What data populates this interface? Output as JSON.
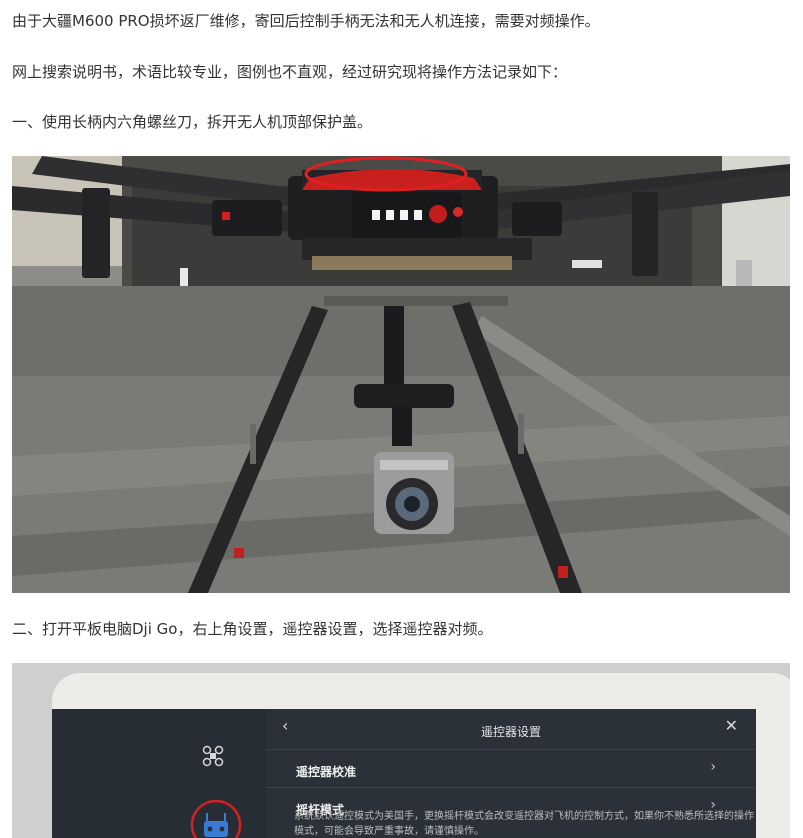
{
  "article": {
    "para1": "由于大疆M600 PRO损坏返厂维修，寄回后控制手柄无法和无人机连接，需要对频操作。",
    "para2": "网上搜索说明书，术语比较专业，图例也不直观，经过研究现将操作方法记录如下：",
    "step1": "一、使用长柄内六角螺丝刀，拆开无人机顶部保护盖。",
    "step2": "二、打开平板电脑Dji Go，右上角设置，遥控器设置，选择遥控器对频。"
  },
  "tablet_screen": {
    "title": "遥控器设置",
    "rows": [
      {
        "label": "遥控器校准"
      },
      {
        "label": "摇杆模式"
      }
    ],
    "stick_mode_desc": "系统默认遥控模式为美国手，更换摇杆模式会改变遥控器对飞机的控制方式，如果你不熟悉所选择的操作模式，可能会导致严重事故，请谨慎操作。",
    "icons": [
      "back-icon",
      "close-icon",
      "drone-icon",
      "remote-controller-icon",
      "chevron-right-icon"
    ]
  },
  "colors": {
    "text": "#333333",
    "annotation_red": "#e02020",
    "drone_body": "#1f1f22",
    "led_white": "#f4f4f4",
    "screen_bg": "#2a3139",
    "rc_icon_blue": "#3a7bd5"
  }
}
